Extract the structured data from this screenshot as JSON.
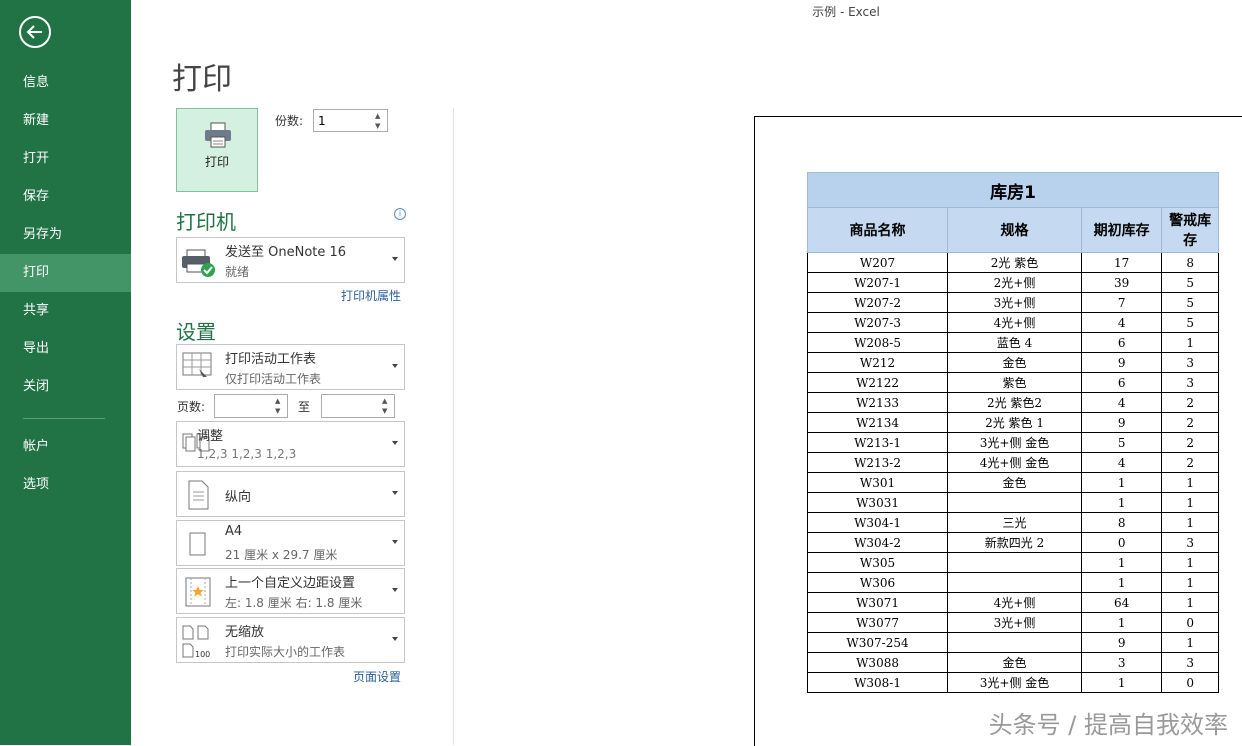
{
  "window": {
    "title": "示例 - Excel"
  },
  "sidebar": {
    "items": [
      {
        "label": "信息",
        "active": false
      },
      {
        "label": "新建",
        "active": false
      },
      {
        "label": "打开",
        "active": false
      },
      {
        "label": "保存",
        "active": false
      },
      {
        "label": "另存为",
        "active": false
      },
      {
        "label": "打印",
        "active": true
      },
      {
        "label": "共享",
        "active": false
      },
      {
        "label": "导出",
        "active": false
      },
      {
        "label": "关闭",
        "active": false
      }
    ],
    "bottom_items": [
      {
        "label": "帐户"
      },
      {
        "label": "选项"
      }
    ],
    "accent_color": "#217346"
  },
  "print": {
    "page_title": "打印",
    "print_button_label": "打印",
    "copies_label": "份数:",
    "copies_value": "1",
    "printer_heading": "打印机",
    "printer_name": "发送至 OneNote 16",
    "printer_status": "就绪",
    "printer_properties_link": "打印机属性",
    "settings_heading": "设置",
    "what_main": "打印活动工作表",
    "what_sub": "仅打印活动工作表",
    "pages_label": "页数:",
    "pages_to_label": "至",
    "pages_from_value": "",
    "pages_to_value": "",
    "collate_main": "调整",
    "collate_sub": "1,2,3    1,2,3    1,2,3",
    "orientation_main": "纵向",
    "paper_main": "A4",
    "paper_sub": "21 厘米 x 29.7 厘米",
    "margins_main": "上一个自定义边距设置",
    "margins_sub": "左:  1.8 厘米     右:  1.8 厘米",
    "scaling_main": "无缩放",
    "scaling_sub": "打印实际大小的工作表",
    "page_setup_link": "页面设置"
  },
  "preview": {
    "table_title": "库房1",
    "headers": [
      "商品名称",
      "规格",
      "期初库存",
      "警戒库存"
    ],
    "rows": [
      [
        "W207",
        "2光 紫色",
        "17",
        "8"
      ],
      [
        "W207-1",
        "2光+侧",
        "39",
        "5"
      ],
      [
        "W207-2",
        "3光+侧",
        "7",
        "5"
      ],
      [
        "W207-3",
        "4光+侧",
        "4",
        "5"
      ],
      [
        "W208-5",
        "蓝色 4",
        "6",
        "1"
      ],
      [
        "W212",
        "金色",
        "9",
        "3"
      ],
      [
        "W2122",
        "紫色",
        "6",
        "3"
      ],
      [
        "W2133",
        "2光 紫色2",
        "4",
        "2"
      ],
      [
        "W2134",
        "2光 紫色 1",
        "9",
        "2"
      ],
      [
        "W213-1",
        "3光+侧 金色",
        "5",
        "2"
      ],
      [
        "W213-2",
        "4光+侧 金色",
        "4",
        "2"
      ],
      [
        "W301",
        "金色",
        "1",
        "1"
      ],
      [
        "W3031",
        "",
        "1",
        "1"
      ],
      [
        "W304-1",
        "三光",
        "8",
        "1"
      ],
      [
        "W304-2",
        "新款四光 2",
        "0",
        "3"
      ],
      [
        "W305",
        "",
        "1",
        "1"
      ],
      [
        "W306",
        "",
        "1",
        "1"
      ],
      [
        "W3071",
        "4光+侧",
        "64",
        "1"
      ],
      [
        "W3077",
        "3光+侧",
        "1",
        "0"
      ],
      [
        "W307-254",
        "",
        "9",
        "1"
      ],
      [
        "W3088",
        "金色",
        "3",
        "3"
      ],
      [
        "W308-1",
        "3光+侧 金色",
        "1",
        "0"
      ]
    ]
  },
  "watermark": "头条号 / 提高自我效率"
}
